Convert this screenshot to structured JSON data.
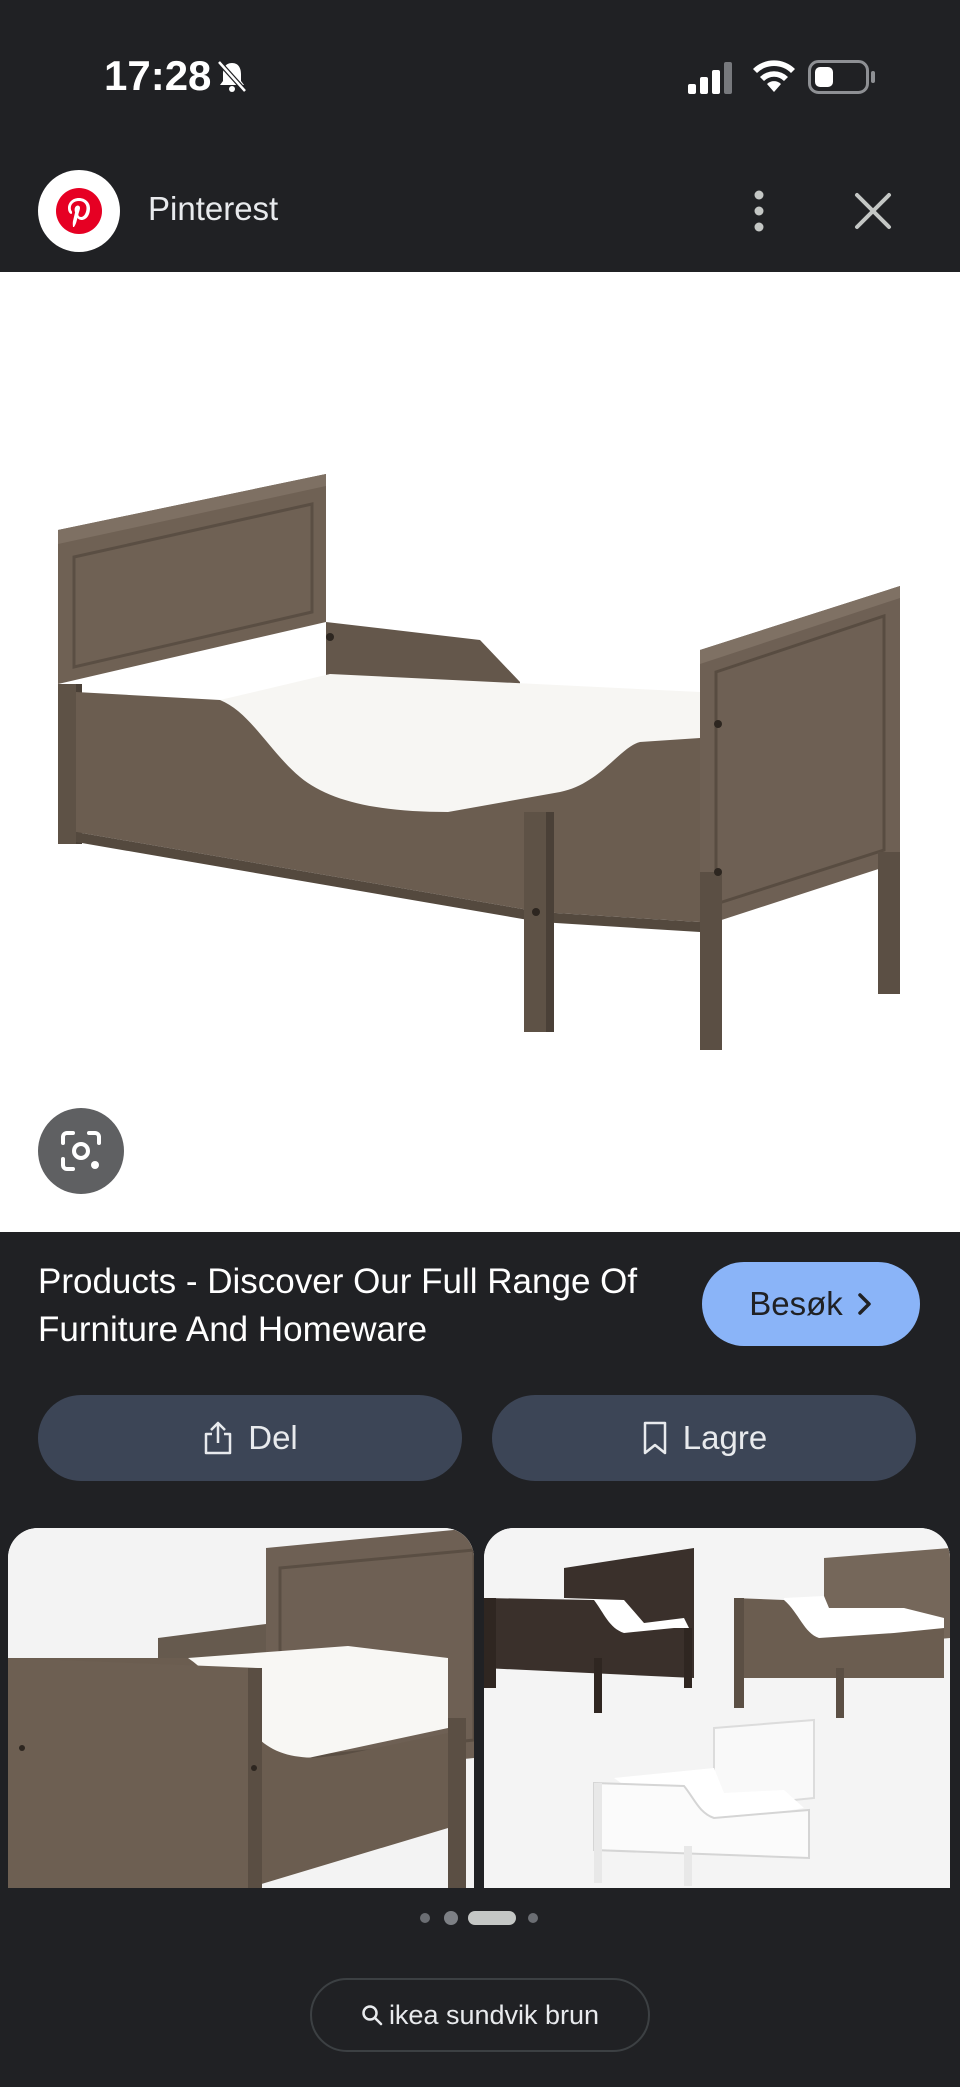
{
  "status_bar": {
    "time": "17:28",
    "icons": [
      "bell-muted-icon",
      "cellular-signal-icon",
      "wifi-icon",
      "battery-icon"
    ]
  },
  "header": {
    "site_name": "Pinterest",
    "logo_icon": "pinterest-logo-icon",
    "menu_icon": "more-vert-icon",
    "close_icon": "close-icon"
  },
  "main_image": {
    "lens_icon": "google-lens-icon"
  },
  "result": {
    "title": "Products - Discover Our Full Range Of Furniture And Homeware",
    "visit_label": "Besøk"
  },
  "actions": {
    "share_label": "Del",
    "save_label": "Lagre"
  },
  "pager": {
    "count": 4,
    "active_index": 2
  },
  "search_chip": {
    "query": "ikea sundvik brun"
  },
  "colors": {
    "background": "#202124",
    "accent": "#8ab4f8",
    "button": "#3c4556",
    "wood": "#6b5d50",
    "pinterest_red": "#e60023"
  }
}
